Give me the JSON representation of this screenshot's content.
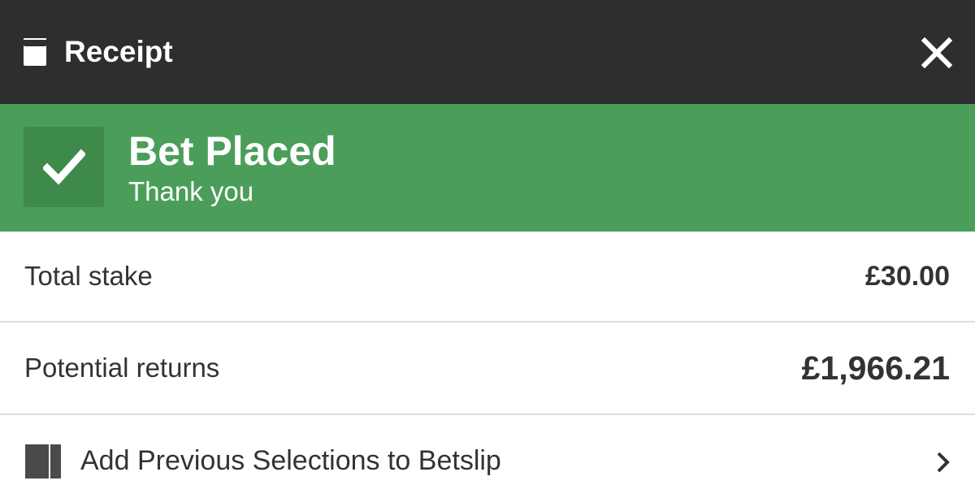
{
  "header": {
    "title": "Receipt",
    "icon": "receipt-icon",
    "close_icon": "close-icon"
  },
  "banner": {
    "title": "Bet Placed",
    "subtitle": "Thank you",
    "icon": "check-icon",
    "color": "#4b9e5a"
  },
  "summary": {
    "stake_label": "Total stake",
    "stake_value": "£30.00",
    "returns_label": "Potential returns",
    "returns_value": "£1,966.21"
  },
  "action": {
    "label": "Add Previous Selections to Betslip",
    "icon": "betslip-cards-icon",
    "chevron": "chevron-right-icon"
  },
  "colors": {
    "header_bg": "#2e2e2e",
    "success_green": "#4b9e5a",
    "text": "#333333"
  }
}
